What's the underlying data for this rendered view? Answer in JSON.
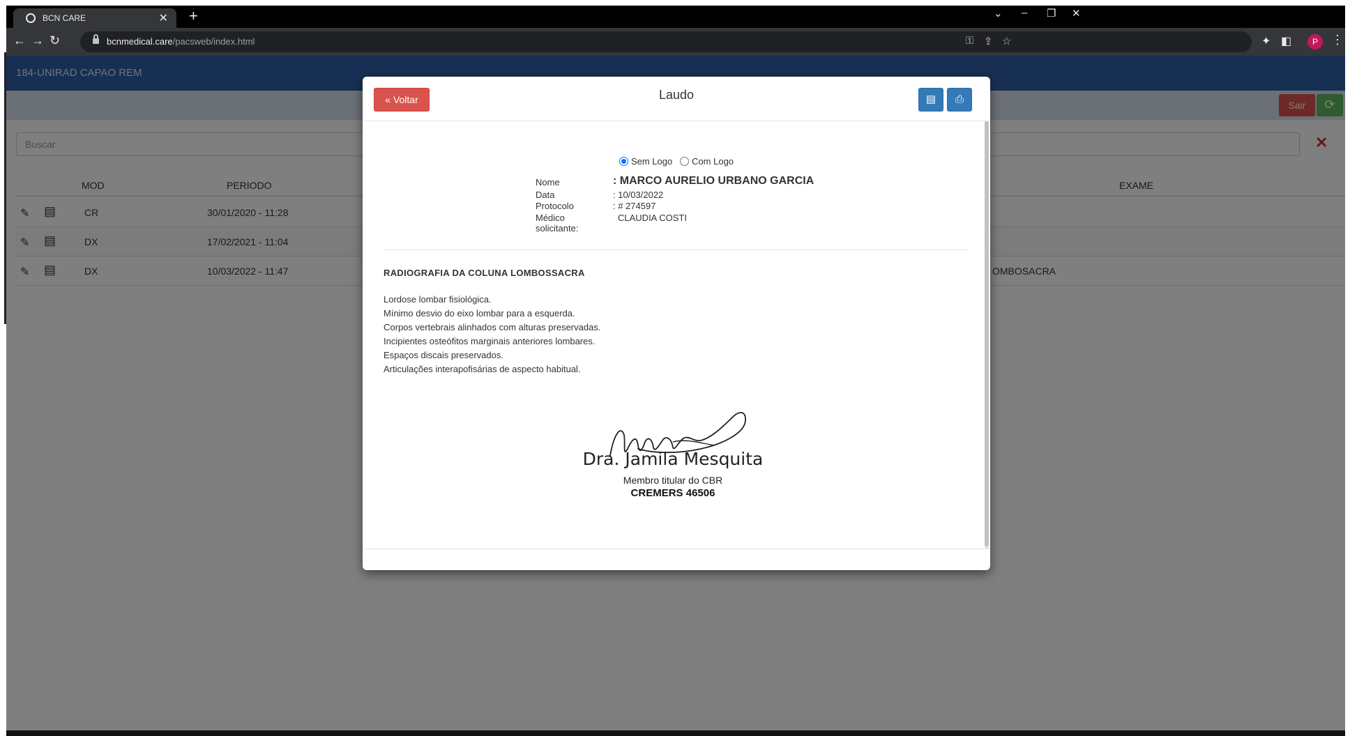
{
  "browser": {
    "tab_title": "BCN CARE",
    "tab_close": "✕",
    "new_tab": "+",
    "url_host": "bcnmedical.care",
    "url_path": "/pacsweb/index.html",
    "avatar_letter": "P"
  },
  "app": {
    "unit_name": "184-UNIRAD CAPAO REM",
    "sair_label": "Sair",
    "search_placeholder": "Buscar",
    "columns": {
      "mod": "MOD",
      "periodo": "PERIODO",
      "exame": "EXAME"
    },
    "rows": [
      {
        "mod": "CR",
        "periodo": "30/01/2020 - 11:28",
        "exame": ""
      },
      {
        "mod": "DX",
        "periodo": "17/02/2021 - 11:04",
        "exame": ""
      },
      {
        "mod": "DX",
        "periodo": "10/03/2022 - 11:47",
        "exame": "OMBOSACRA"
      }
    ]
  },
  "modal": {
    "back_label": "Voltar",
    "title": "Laudo",
    "radio_sem_logo": "Sem Logo",
    "radio_com_logo": "Com Logo",
    "patient": {
      "nome_label": "Nome",
      "nome_value": ": MARCO AURELIO URBANO GARCIA",
      "data_label": "Data",
      "data_value": ": 10/03/2022",
      "protocolo_label": "Protocolo",
      "protocolo_value": ": # 274597",
      "medico_label": "Médico solicitante:",
      "medico_value": "CLAUDIA COSTI"
    },
    "report_title": "RADIOGRAFIA DA COLUNA LOMBOSSACRA",
    "report_lines": [
      "Lordose lombar fisiológica.",
      "Mínimo desvio do eixo lombar para a esquerda.",
      "Corpos vertebrais alinhados com alturas preservadas.",
      "Incipientes osteófitos marginais anteriores lombares.",
      "Espaços discais preservados.",
      "Articulações interapofisárias de aspecto habitual."
    ],
    "signature": {
      "name": "Dra. Jamila Mesquita",
      "role": "Membro titular do CBR",
      "crm": "CREMERS 46506"
    }
  },
  "colors": {
    "header_blue": "#2e5fa6",
    "danger_red": "#d9534f",
    "primary_blue": "#337ab7",
    "success_green": "#5cb85c"
  }
}
